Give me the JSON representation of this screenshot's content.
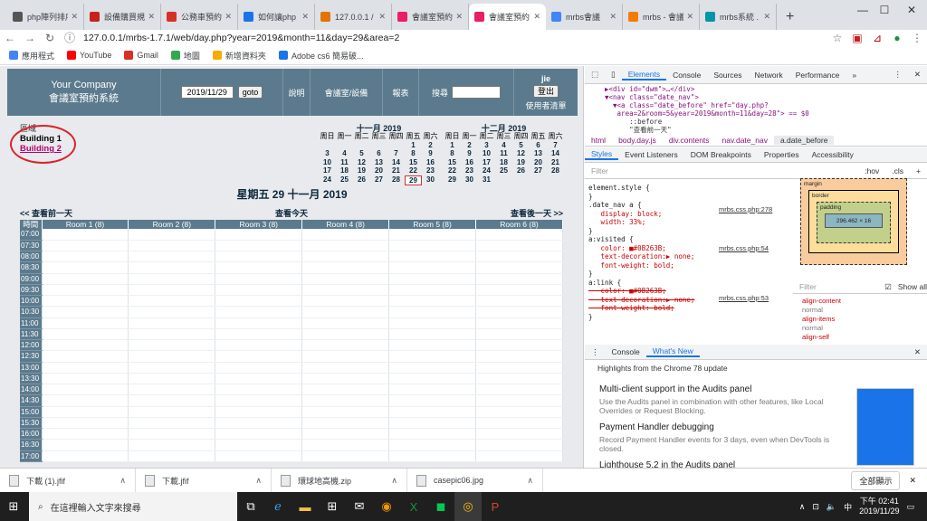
{
  "browser": {
    "tabs": [
      {
        "label": "php陣列排序",
        "fav_color": "#555",
        "active": false
      },
      {
        "label": "設備購買規",
        "fav_color": "#c5221f",
        "active": false
      },
      {
        "label": "公務車預約",
        "fav_color": "#d93025",
        "active": false
      },
      {
        "label": "如何讓php",
        "fav_color": "#1a73e8",
        "active": false
      },
      {
        "label": "127.0.0.1 /",
        "fav_color": "#e37400",
        "active": false
      },
      {
        "label": "會議室預約",
        "fav_color": "#e91e63",
        "active": false
      },
      {
        "label": "會議室預約",
        "fav_color": "#e91e63",
        "active": true
      },
      {
        "label": "mrbs會議",
        "fav_color": "#4285f4",
        "active": false
      },
      {
        "label": "mrbs - 會議",
        "fav_color": "#f57c00",
        "active": false
      },
      {
        "label": "mrbs系統 .",
        "fav_color": "#0097a7",
        "active": false
      }
    ],
    "url": "127.0.0.1/mrbs-1.7.1/web/day.php?year=2019&month=11&day=29&area=2",
    "bookmarks": [
      {
        "label": "應用程式",
        "color": "#4285f4"
      },
      {
        "label": "YouTube",
        "color": "#ff0000"
      },
      {
        "label": "Gmail",
        "color": "#d93025"
      },
      {
        "label": "地圖",
        "color": "#34a853"
      },
      {
        "label": "新增資料夾",
        "color": "#f9ab00"
      },
      {
        "label": "Adobe cs6 簡易破...",
        "color": "#1a73e8"
      }
    ]
  },
  "mrbs": {
    "company": "Your Company",
    "system_name": "會議室預約系統",
    "date_value": "2019/11/29",
    "goto_label": "goto",
    "menu": [
      "說明",
      "會議室/設備",
      "報表"
    ],
    "search_label": "搜尋",
    "user_name": "jie",
    "logout_label": "登出",
    "user_list_label": "使用者清單",
    "area_label": "區域",
    "areas": [
      "Building 1",
      "Building 2"
    ],
    "calendars": [
      {
        "title": "十一月 2019",
        "weekdays": [
          "周日",
          "周一",
          "周二",
          "周三",
          "周四",
          "周五",
          "周六"
        ],
        "weeks": [
          [
            "",
            "",
            "",
            "",
            "",
            "1",
            "2"
          ],
          [
            "3",
            "4",
            "5",
            "6",
            "7",
            "8",
            "9"
          ],
          [
            "10",
            "11",
            "12",
            "13",
            "14",
            "15",
            "16"
          ],
          [
            "17",
            "18",
            "19",
            "20",
            "21",
            "22",
            "23"
          ],
          [
            "24",
            "25",
            "26",
            "27",
            "28",
            "29",
            "30"
          ]
        ],
        "selected": "29"
      },
      {
        "title": "十二月 2019",
        "weekdays": [
          "周日",
          "周一",
          "周二",
          "周三",
          "周四",
          "周五",
          "周六"
        ],
        "weeks": [
          [
            "1",
            "2",
            "3",
            "4",
            "5",
            "6",
            "7"
          ],
          [
            "8",
            "9",
            "10",
            "11",
            "12",
            "13",
            "14"
          ],
          [
            "15",
            "16",
            "17",
            "18",
            "19",
            "20",
            "21"
          ],
          [
            "22",
            "23",
            "24",
            "25",
            "26",
            "27",
            "28"
          ],
          [
            "29",
            "30",
            "31",
            "",
            "",
            "",
            ""
          ]
        ],
        "selected": ""
      }
    ],
    "day_title": "星期五 29 十一月 2019",
    "prev_day": "<< 查看前一天",
    "today": "查看今天",
    "next_day": "查看後一天 >>",
    "time_header": "時間",
    "rooms": [
      "Room 1 (8)",
      "Room 2 (8)",
      "Room 3 (8)",
      "Room 4 (8)",
      "Room 5 (8)",
      "Room 6 (8)"
    ],
    "times": [
      "07:00",
      "07:30",
      "08:00",
      "08:30",
      "09:00",
      "09:30",
      "10:00",
      "10:30",
      "11:00",
      "11:30",
      "12:00",
      "12:30",
      "13:00",
      "13:30",
      "14:00",
      "14:30",
      "15:00",
      "15:30",
      "16:00",
      "16:30",
      "17:00"
    ]
  },
  "devtools": {
    "tabs": [
      "Elements",
      "Console",
      "Sources",
      "Network",
      "Performance",
      "»"
    ],
    "dom_lines": [
      "▶<div id=\"dwm\">…</div>",
      "▼<nav class=\"date_nav\">",
      "  ▼<a class=\"date_before\" href=\"day.php?",
      "   area=2&room=5&year=2019&month=11&day=28\"> == $0",
      "      ::before",
      "      \"查看前一天\""
    ],
    "breadcrumbs": [
      "html",
      "body.day.js",
      "div.contents",
      "nav.date_nav",
      "a.date_before"
    ],
    "style_tabs": [
      "Styles",
      "Event Listeners",
      "DOM Breakpoints",
      "Properties",
      "Accessibility"
    ],
    "filter_placeholder": "Filter",
    "hov_label": ":hov",
    "cls_label": ".cls",
    "css_rules": [
      "element.style {",
      "}",
      ".date_nav a {",
      "   display: block;",
      "   width: 33%;",
      "}",
      "a:visited {",
      "   color: ■#0B263B;",
      "   text-decoration:▶ none;",
      "   font-weight: bold;",
      "}",
      "a:link {",
      "   color: ■#0B263B;",
      "   text-decoration:▶ none;",
      "   font-weight: bold;",
      "}"
    ],
    "css_sources": [
      "mrbs.css.php:278",
      "mrbs.css.php:54",
      "mrbs.css.php:53"
    ],
    "box_model": {
      "margin": "margin",
      "border": "border",
      "padding": "padding",
      "content": "296.462 × 16",
      "dash": "–"
    },
    "computed_filter": "Filter",
    "show_all": "Show all",
    "computed_props": [
      {
        "name": "align-content",
        "value": "normal"
      },
      {
        "name": "align-items",
        "value": "normal"
      },
      {
        "name": "align-self",
        "value": ""
      }
    ],
    "drawer_tabs": [
      "Console",
      "What's New"
    ],
    "whats_new_header": "Highlights from the Chrome 78 update",
    "news": [
      {
        "title": "Multi-client support in the Audits panel",
        "body": "Use the Audits panel in combination with other features, like Local Overrides or Request Blocking."
      },
      {
        "title": "Payment Handler debugging",
        "body": "Record Payment Handler events for 3 days, even when DevTools is closed."
      },
      {
        "title": "Lighthouse 5.2 in the Audits panel",
        "body": ""
      }
    ]
  },
  "downloads": {
    "items": [
      "下載 (1).jfif",
      "下載.jfif",
      "環球地高機.zip",
      "casepic06.jpg"
    ],
    "show_all": "全部顯示"
  },
  "taskbar": {
    "search_placeholder": "在這裡輸入文字來搜尋",
    "time": "下午 02:41",
    "date": "2019/11/29",
    "ime": "中"
  }
}
